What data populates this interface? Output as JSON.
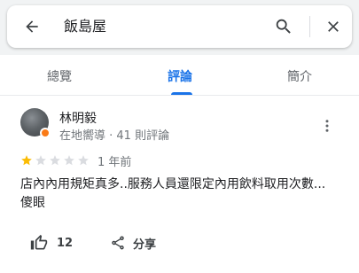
{
  "search": {
    "query": "飯島屋"
  },
  "tabs": [
    {
      "label": "總覽"
    },
    {
      "label": "評論"
    },
    {
      "label": "簡介"
    }
  ],
  "review": {
    "author": "林明毅",
    "author_meta": "在地嚮導 · 41 則評論",
    "rating": 1,
    "rating_max": 5,
    "date": "1 年前",
    "text_line1": "店內內用規矩真多..服務人員還限定內用飲料取用次數...",
    "text_line2": "傻眼",
    "likes": "12",
    "share_label": "分享"
  },
  "colors": {
    "accent": "#1a73e8",
    "star_filled": "#fbbc04",
    "star_empty": "#dadce0",
    "badge": "#fa7b17"
  },
  "icons": {
    "back": "arrow-left-icon",
    "search": "search-icon",
    "close": "close-icon",
    "more": "more-vert-icon",
    "like": "thumb-up-icon",
    "share": "share-icon"
  }
}
